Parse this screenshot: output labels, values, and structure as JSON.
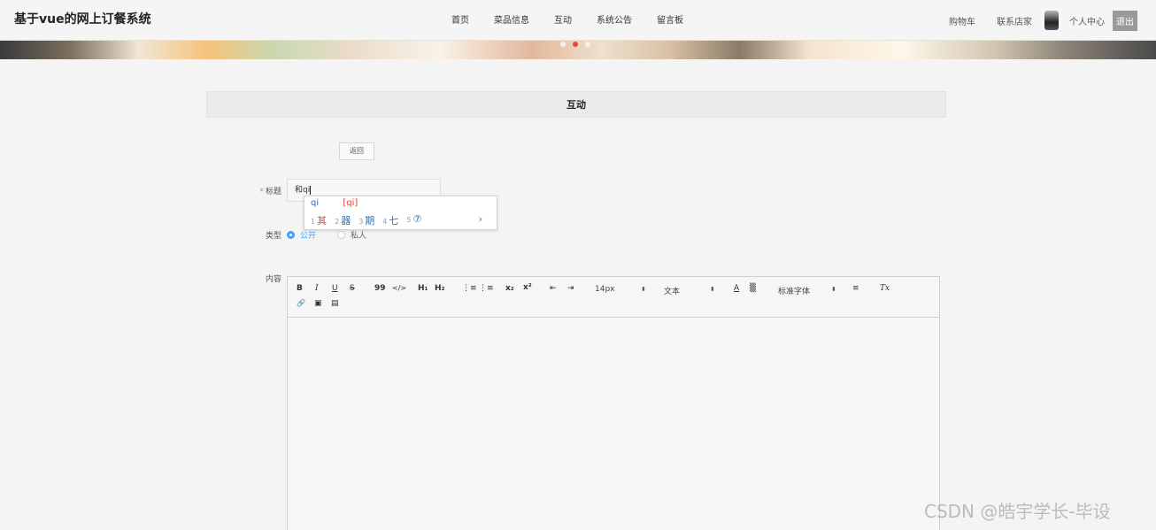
{
  "header": {
    "site_title": "基于vue的网上订餐系统",
    "nav": [
      "首页",
      "菜品信息",
      "互动",
      "系统公告",
      "留言板"
    ],
    "cart": "购物车",
    "contact": "联系店家",
    "personal": "个人中心",
    "logout": "退出"
  },
  "section": {
    "title": "互动"
  },
  "form": {
    "back_label": "返回",
    "title_label": "标题",
    "title_value": "和qi",
    "type_label": "类型",
    "type_options": [
      "公开",
      "私人"
    ],
    "type_selected": "公开",
    "content_label": "内容"
  },
  "ime": {
    "pinyin": "qi",
    "hint": "[qi]",
    "candidates": [
      {
        "num": "1",
        "text": "其"
      },
      {
        "num": "2",
        "text": "器"
      },
      {
        "num": "3",
        "text": "期"
      },
      {
        "num": "4",
        "text": "七"
      },
      {
        "num": "5",
        "text": "⑦"
      }
    ],
    "next": "›"
  },
  "editor": {
    "buttons": {
      "bold": "B",
      "italic": "I",
      "underline": "U",
      "strike": "S",
      "blockquote": "99",
      "code": "</>",
      "h1": "H₁",
      "h2": "H₂",
      "ordered_list": "⋮≡",
      "bullet_list": "⋮≡",
      "subscript": "x₂",
      "superscript": "x²",
      "outdent": "⇤",
      "indent": "⇥",
      "color": "A",
      "background": "▒",
      "align": "≡",
      "clean": "Tx",
      "link": "🔗",
      "image": "▣",
      "video": "▤"
    },
    "size": "14px",
    "header_select": "文本",
    "font_select": "标准字体",
    "chevron": "⬍"
  },
  "watermark": "CSDN @皓宇学长-毕设"
}
